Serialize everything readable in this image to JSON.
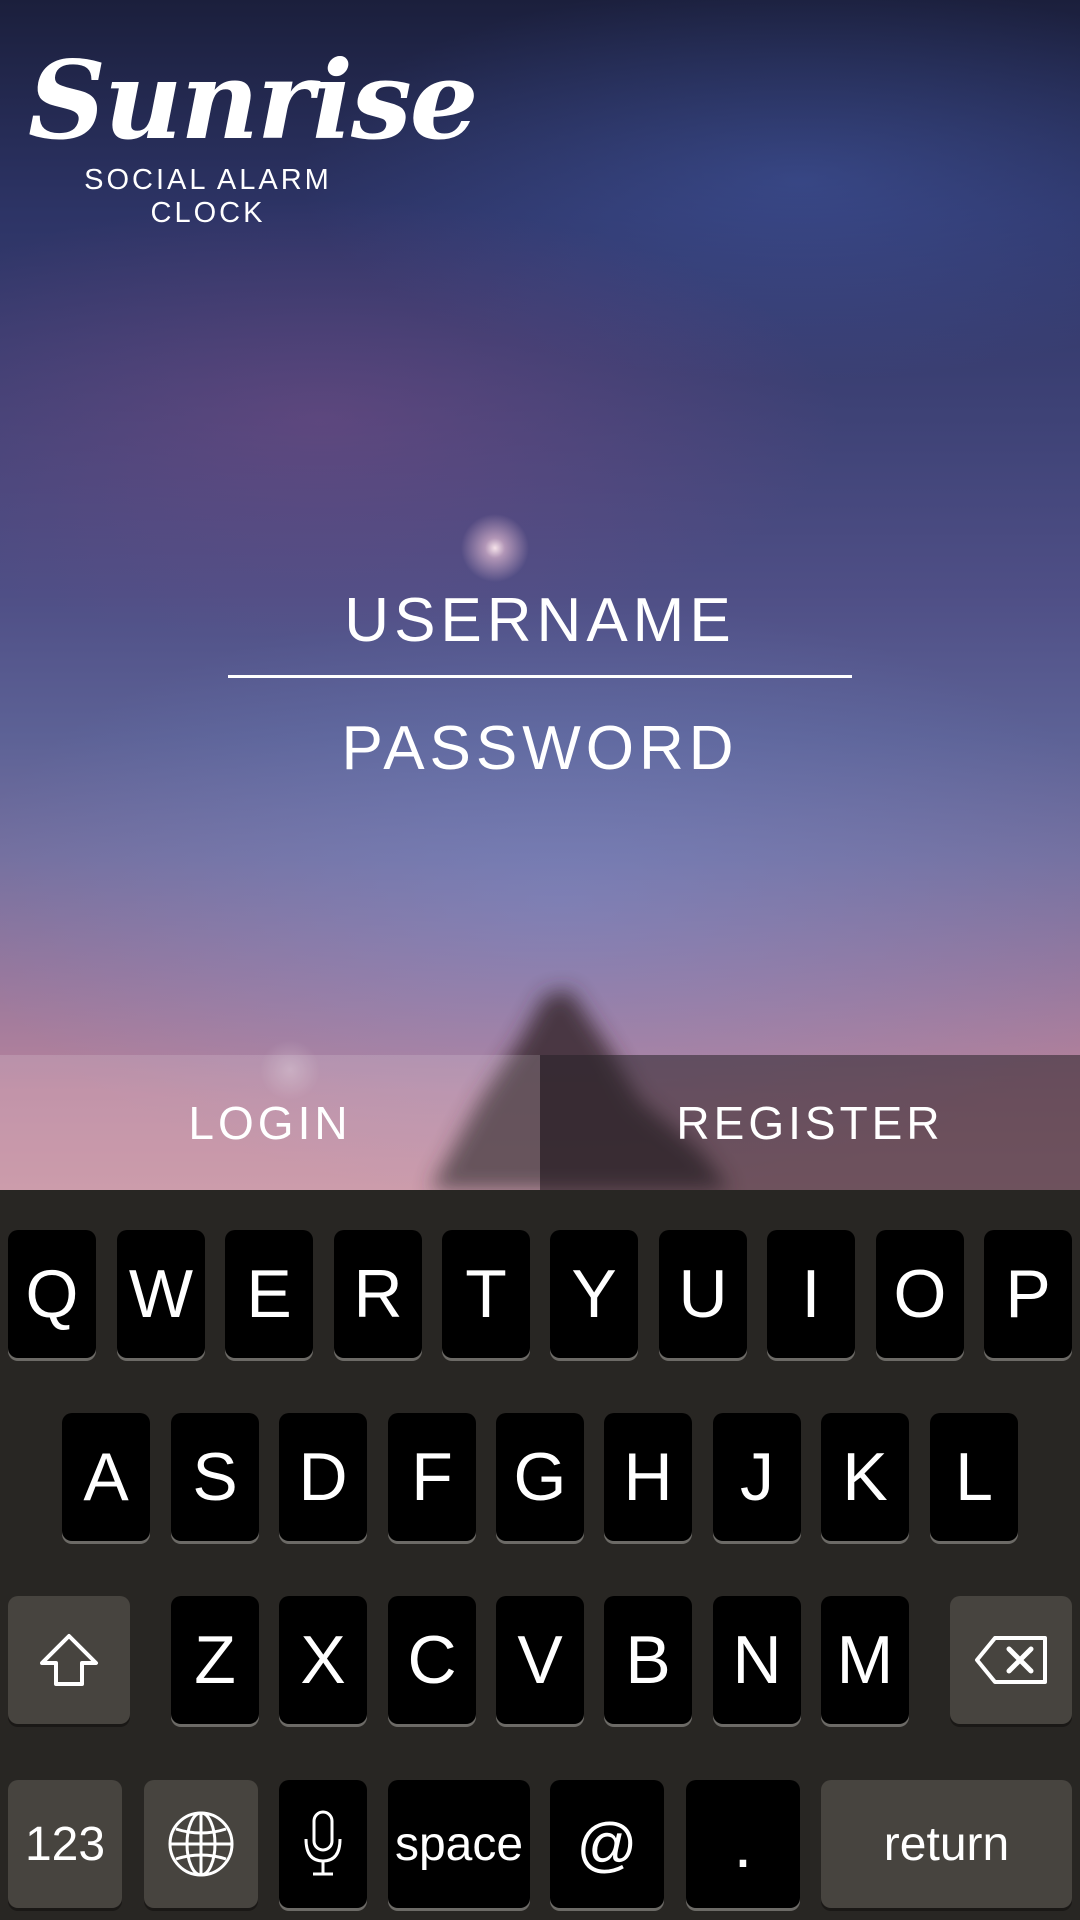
{
  "app": {
    "title": "Sunrise",
    "subtitle": "SOCIAL ALARM CLOCK"
  },
  "form": {
    "username_placeholder": "USERNAME",
    "username_value": "",
    "password_placeholder": "PASSWORD",
    "password_value": ""
  },
  "actions": {
    "login_label": "LOGIN",
    "register_label": "REGISTER"
  },
  "keyboard": {
    "row1": [
      "Q",
      "W",
      "E",
      "R",
      "T",
      "Y",
      "U",
      "I",
      "O",
      "P"
    ],
    "row2": [
      "A",
      "S",
      "D",
      "F",
      "G",
      "H",
      "J",
      "K",
      "L"
    ],
    "row3": [
      "Z",
      "X",
      "C",
      "V",
      "B",
      "N",
      "M"
    ],
    "numbers_label": "123",
    "space_label": "space",
    "at_label": "@",
    "period_label": ".",
    "return_label": "return",
    "icons": {
      "shift": "shift-icon",
      "backspace": "backspace-icon",
      "globe": "globe-icon",
      "mic": "microphone-icon"
    }
  },
  "colors": {
    "keyboard_bg": "#282623",
    "key_bg": "#000000",
    "function_key_bg": "#47443f",
    "text": "#ffffff"
  }
}
